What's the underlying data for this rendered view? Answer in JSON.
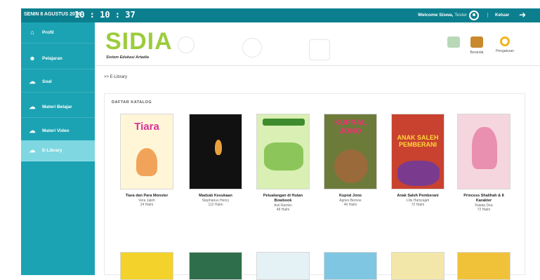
{
  "topbar": {
    "date": "SENIN 8 AGUSTUS 2016",
    "time": "10 : 10 : 37",
    "welcome": "Welcome Siswa,",
    "user": "Tester",
    "logout": "Keluar"
  },
  "sidebar": {
    "items": [
      {
        "label": "Profil",
        "icon": "home-icon"
      },
      {
        "label": "Pelajaran",
        "icon": "users-icon"
      },
      {
        "label": "Soal",
        "icon": "cloud-icon"
      },
      {
        "label": "Materi Belajar",
        "icon": "cloud-icon"
      },
      {
        "label": "Materi Video",
        "icon": "cloud-icon"
      },
      {
        "label": "E-Library",
        "icon": "cloud-icon",
        "active": true
      }
    ]
  },
  "header": {
    "logo": "SIDIA",
    "logo_sub": "Sistem Edukasi Artadia",
    "buttons": [
      {
        "label": "",
        "icon": "monitor-icon"
      },
      {
        "label": "Beranda",
        "icon": "home-icon"
      },
      {
        "label": "Pengaturan",
        "icon": "settings-icon"
      }
    ]
  },
  "breadcrumb": ">> E-Library",
  "catalog": {
    "title": "DAFTAR KATALOG",
    "books": [
      {
        "title": "Tiara dan Para Monster",
        "author": "Vera Jaleh",
        "pages": "24 Halm",
        "cover_text": "Tiara",
        "cover_bg": "#fff6d8",
        "cover_fg": "#d6339a"
      },
      {
        "title": "Madzab Kesukaan",
        "author": "Stephanus Henry",
        "pages": "112 Halm",
        "cover_text": "",
        "cover_bg": "#111111",
        "cover_fg": "#e9a23b"
      },
      {
        "title": "Petualangan di Hutan Bowbook",
        "author": "Asti Ramko",
        "pages": "48 Halm",
        "cover_text": "",
        "cover_bg": "#d9efb4",
        "cover_fg": "#3e8c2d"
      },
      {
        "title": "Kupral Jono",
        "author": "Agnes Bemoe",
        "pages": "40 Halm",
        "cover_text": "KUPRAL JONO",
        "cover_bg": "#6c7b3a",
        "cover_fg": "#e8356f"
      },
      {
        "title": "Anak Saleh Pemberani",
        "author": "Lilis Hamzajah",
        "pages": "72 Halm",
        "cover_text": "ANAK SALEH PEMBERANI",
        "cover_bg": "#c9412f",
        "cover_fg": "#ffd83b"
      },
      {
        "title": "Princess Shalihah & 8 Karakter",
        "author": "Ratata Dea",
        "pages": "72 Halm",
        "cover_text": "",
        "cover_bg": "#f5d6de",
        "cover_fg": "#d6336c"
      }
    ]
  },
  "colors": {
    "topbar": "#0c7f8f",
    "sidebar": "#1ba3b3",
    "sidebar_active": "#7fd7e1",
    "logo": "#9ccc3d"
  }
}
